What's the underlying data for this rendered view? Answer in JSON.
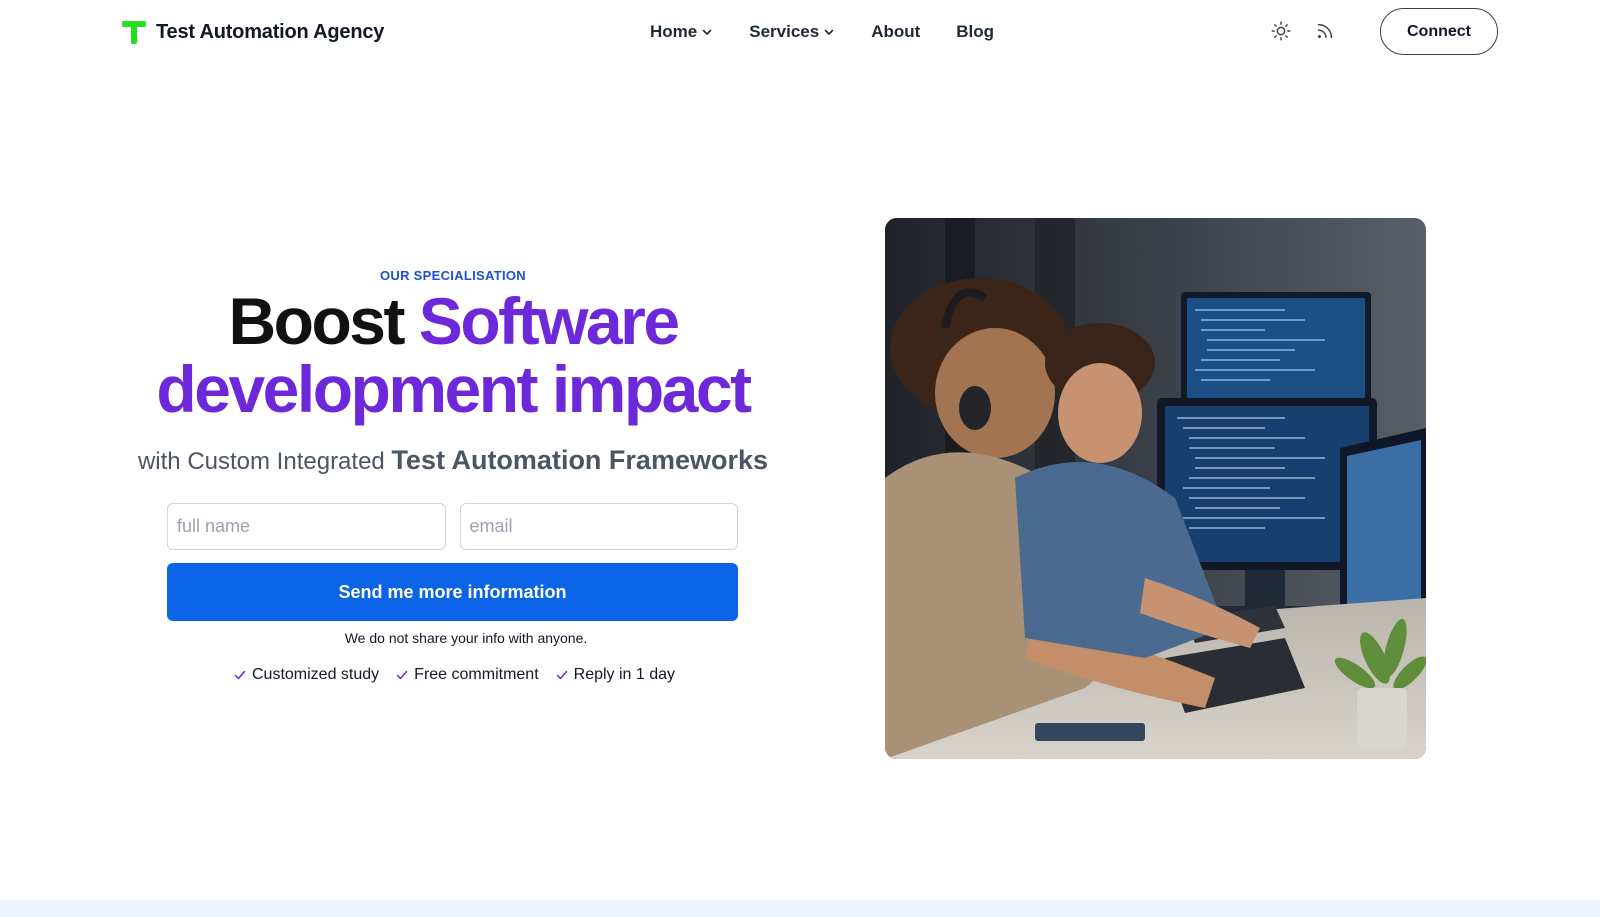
{
  "header": {
    "brand": "Test Automation Agency",
    "nav": [
      {
        "label": "Home",
        "has_dropdown": true
      },
      {
        "label": "Services",
        "has_dropdown": true
      },
      {
        "label": "About",
        "has_dropdown": false
      },
      {
        "label": "Blog",
        "has_dropdown": false
      }
    ],
    "icons": [
      "sun-icon",
      "rss-icon"
    ],
    "connect_label": "Connect"
  },
  "hero": {
    "eyebrow": "OUR SPECIALISATION",
    "headline_dark": "Boost",
    "headline_purple_1": "Software",
    "headline_purple_2": "development impact",
    "sub_1": "with",
    "sub_2": "Custom Integrated",
    "sub_3": "Test Automation Frameworks",
    "form": {
      "name_placeholder": "full name",
      "email_placeholder": "email",
      "submit_label": "Send me more information"
    },
    "privacy_note": "We do not share your info with anyone.",
    "benefits": [
      "Customized study",
      "Free commitment",
      "Reply in 1 day"
    ]
  },
  "colors": {
    "brand_green": "#22e01d",
    "accent_purple": "#6d28d9",
    "primary_blue": "#0b63e5",
    "eyebrow_blue": "#1d4ed8"
  }
}
